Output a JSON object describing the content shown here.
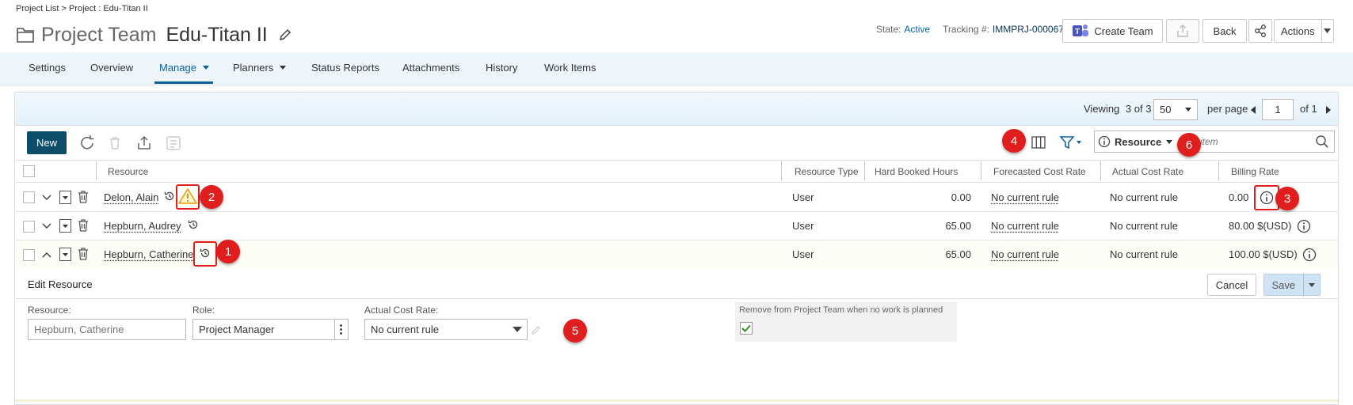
{
  "breadcrumb": "Project List > Project : Edu-Titan II",
  "header": {
    "kind": "Project Team",
    "name": "Edu-Titan II",
    "state_label": "State:",
    "state_value": "Active",
    "tracking_label": "Tracking #:",
    "tracking_value": "IMMPRJ-000067",
    "create_team_label": "Create Team",
    "back_label": "Back",
    "actions_label": "Actions"
  },
  "tabs": [
    {
      "label": "Settings"
    },
    {
      "label": "Overview"
    },
    {
      "label": "Manage"
    },
    {
      "label": "Planners"
    },
    {
      "label": "Status Reports"
    },
    {
      "label": "Attachments"
    },
    {
      "label": "History"
    },
    {
      "label": "Work Items"
    }
  ],
  "pager": {
    "viewing_label": "Viewing",
    "viewing_value": "3 of 3",
    "per_page_value": "50",
    "per_page_label": "per page",
    "page_value": "1",
    "of_pages": "of 1"
  },
  "toolbar": {
    "new_label": "New",
    "search_scope": "Resource",
    "search_placeholder": "item"
  },
  "columns": [
    "Resource",
    "Resource Type",
    "Hard Booked Hours",
    "Forecasted Cost Rate",
    "Actual Cost Rate",
    "Billing Rate"
  ],
  "rows": [
    {
      "resource": "Delon, Alain",
      "type": "User",
      "hours": "0.00",
      "forecast": "No current rule",
      "actual": "No current rule",
      "billing": "0.00"
    },
    {
      "resource": "Hepburn, Audrey",
      "type": "User",
      "hours": "65.00",
      "forecast": "No current rule",
      "actual": "No current rule",
      "billing": "80.00 $(USD)"
    },
    {
      "resource": "Hepburn, Catherine",
      "type": "User",
      "hours": "65.00",
      "forecast": "No current rule",
      "actual": "No current rule",
      "billing": "100.00 $(USD)"
    }
  ],
  "edit": {
    "title": "Edit Resource",
    "cancel_label": "Cancel",
    "save_label": "Save",
    "resource_label": "Resource:",
    "resource_placeholder": "Hepburn, Catherine",
    "role_label": "Role:",
    "role_value": "Project Manager",
    "actual_label": "Actual Cost Rate:",
    "actual_value": "No current rule",
    "remove_label": "Remove from Project Team when no work is planned",
    "remove_checked": true
  },
  "badges": [
    "1",
    "2",
    "3",
    "4",
    "5",
    "6"
  ],
  "colors": {
    "accent": "#0b5f9b",
    "badge": "#e11e1e",
    "new_button": "#0e4d6a",
    "link": "#1a63b3"
  }
}
